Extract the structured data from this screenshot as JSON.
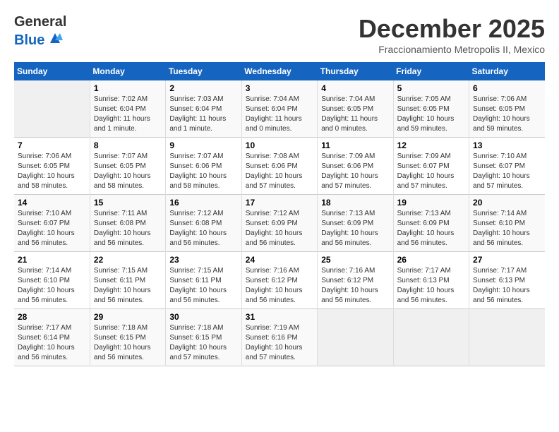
{
  "logo": {
    "general": "General",
    "blue": "Blue"
  },
  "title": {
    "month_year": "December 2025",
    "location": "Fraccionamiento Metropolis II, Mexico"
  },
  "days_of_week": [
    "Sunday",
    "Monday",
    "Tuesday",
    "Wednesday",
    "Thursday",
    "Friday",
    "Saturday"
  ],
  "weeks": [
    [
      {
        "day": "",
        "info": ""
      },
      {
        "day": "1",
        "info": "Sunrise: 7:02 AM\nSunset: 6:04 PM\nDaylight: 11 hours\nand 1 minute."
      },
      {
        "day": "2",
        "info": "Sunrise: 7:03 AM\nSunset: 6:04 PM\nDaylight: 11 hours\nand 1 minute."
      },
      {
        "day": "3",
        "info": "Sunrise: 7:04 AM\nSunset: 6:04 PM\nDaylight: 11 hours\nand 0 minutes."
      },
      {
        "day": "4",
        "info": "Sunrise: 7:04 AM\nSunset: 6:05 PM\nDaylight: 11 hours\nand 0 minutes."
      },
      {
        "day": "5",
        "info": "Sunrise: 7:05 AM\nSunset: 6:05 PM\nDaylight: 10 hours\nand 59 minutes."
      },
      {
        "day": "6",
        "info": "Sunrise: 7:06 AM\nSunset: 6:05 PM\nDaylight: 10 hours\nand 59 minutes."
      }
    ],
    [
      {
        "day": "7",
        "info": "Sunrise: 7:06 AM\nSunset: 6:05 PM\nDaylight: 10 hours\nand 58 minutes."
      },
      {
        "day": "8",
        "info": "Sunrise: 7:07 AM\nSunset: 6:05 PM\nDaylight: 10 hours\nand 58 minutes."
      },
      {
        "day": "9",
        "info": "Sunrise: 7:07 AM\nSunset: 6:06 PM\nDaylight: 10 hours\nand 58 minutes."
      },
      {
        "day": "10",
        "info": "Sunrise: 7:08 AM\nSunset: 6:06 PM\nDaylight: 10 hours\nand 57 minutes."
      },
      {
        "day": "11",
        "info": "Sunrise: 7:09 AM\nSunset: 6:06 PM\nDaylight: 10 hours\nand 57 minutes."
      },
      {
        "day": "12",
        "info": "Sunrise: 7:09 AM\nSunset: 6:07 PM\nDaylight: 10 hours\nand 57 minutes."
      },
      {
        "day": "13",
        "info": "Sunrise: 7:10 AM\nSunset: 6:07 PM\nDaylight: 10 hours\nand 57 minutes."
      }
    ],
    [
      {
        "day": "14",
        "info": "Sunrise: 7:10 AM\nSunset: 6:07 PM\nDaylight: 10 hours\nand 56 minutes."
      },
      {
        "day": "15",
        "info": "Sunrise: 7:11 AM\nSunset: 6:08 PM\nDaylight: 10 hours\nand 56 minutes."
      },
      {
        "day": "16",
        "info": "Sunrise: 7:12 AM\nSunset: 6:08 PM\nDaylight: 10 hours\nand 56 minutes."
      },
      {
        "day": "17",
        "info": "Sunrise: 7:12 AM\nSunset: 6:09 PM\nDaylight: 10 hours\nand 56 minutes."
      },
      {
        "day": "18",
        "info": "Sunrise: 7:13 AM\nSunset: 6:09 PM\nDaylight: 10 hours\nand 56 minutes."
      },
      {
        "day": "19",
        "info": "Sunrise: 7:13 AM\nSunset: 6:09 PM\nDaylight: 10 hours\nand 56 minutes."
      },
      {
        "day": "20",
        "info": "Sunrise: 7:14 AM\nSunset: 6:10 PM\nDaylight: 10 hours\nand 56 minutes."
      }
    ],
    [
      {
        "day": "21",
        "info": "Sunrise: 7:14 AM\nSunset: 6:10 PM\nDaylight: 10 hours\nand 56 minutes."
      },
      {
        "day": "22",
        "info": "Sunrise: 7:15 AM\nSunset: 6:11 PM\nDaylight: 10 hours\nand 56 minutes."
      },
      {
        "day": "23",
        "info": "Sunrise: 7:15 AM\nSunset: 6:11 PM\nDaylight: 10 hours\nand 56 minutes."
      },
      {
        "day": "24",
        "info": "Sunrise: 7:16 AM\nSunset: 6:12 PM\nDaylight: 10 hours\nand 56 minutes."
      },
      {
        "day": "25",
        "info": "Sunrise: 7:16 AM\nSunset: 6:12 PM\nDaylight: 10 hours\nand 56 minutes."
      },
      {
        "day": "26",
        "info": "Sunrise: 7:17 AM\nSunset: 6:13 PM\nDaylight: 10 hours\nand 56 minutes."
      },
      {
        "day": "27",
        "info": "Sunrise: 7:17 AM\nSunset: 6:13 PM\nDaylight: 10 hours\nand 56 minutes."
      }
    ],
    [
      {
        "day": "28",
        "info": "Sunrise: 7:17 AM\nSunset: 6:14 PM\nDaylight: 10 hours\nand 56 minutes."
      },
      {
        "day": "29",
        "info": "Sunrise: 7:18 AM\nSunset: 6:15 PM\nDaylight: 10 hours\nand 56 minutes."
      },
      {
        "day": "30",
        "info": "Sunrise: 7:18 AM\nSunset: 6:15 PM\nDaylight: 10 hours\nand 57 minutes."
      },
      {
        "day": "31",
        "info": "Sunrise: 7:19 AM\nSunset: 6:16 PM\nDaylight: 10 hours\nand 57 minutes."
      },
      {
        "day": "",
        "info": ""
      },
      {
        "day": "",
        "info": ""
      },
      {
        "day": "",
        "info": ""
      }
    ]
  ]
}
